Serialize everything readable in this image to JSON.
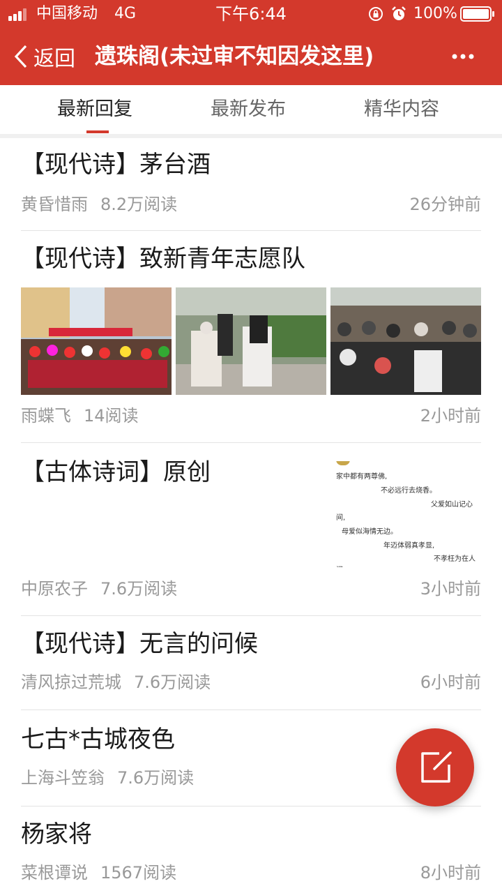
{
  "statusbar": {
    "carrier": "中国移动",
    "network": "4G",
    "time": "下午6:44",
    "battery": "100%",
    "icons": [
      "signal-icon",
      "orientation-lock-icon",
      "alarm-icon",
      "battery-icon"
    ]
  },
  "navbar": {
    "back_label": "返回",
    "title": "遗珠阁(未过审不知因发这里)",
    "more_icon": "more-dots-icon",
    "background": "#d3392c"
  },
  "tabs": [
    {
      "label": "最新回复",
      "active": true
    },
    {
      "label": "最新发布",
      "active": false
    },
    {
      "label": "精华内容",
      "active": false
    }
  ],
  "posts": [
    {
      "title": "【现代诗】茅台酒",
      "author": "黄昏惜雨",
      "reads": "8.2万阅读",
      "time": "26分钟前"
    },
    {
      "title": "【现代诗】致新青年志愿队",
      "author": "雨蝶飞",
      "reads": "14阅读",
      "time": "2小时前"
    },
    {
      "title": "【古体诗词】原创",
      "author": "中原农子",
      "reads": "7.6万阅读",
      "time": "3小时前",
      "thumb_lines": [
        "家中都有两尊佛,",
        "不必远行去烧香。",
        "父爱如山记心",
        "间,",
        "母爱似海情无边。",
        "年迈体弱真孝显,",
        "不孝枉为在人",
        "间。"
      ]
    },
    {
      "title": "【现代诗】无言的问候",
      "author": "清风掠过荒城",
      "reads": "7.6万阅读",
      "time": "6小时前"
    },
    {
      "title": "七古*古城夜色",
      "author": "上海斗笠翁",
      "reads": "7.6万阅读",
      "time": ""
    },
    {
      "title": "杨家将",
      "author": "菜根谭说",
      "reads": "1567阅读",
      "time": "8小时前"
    }
  ],
  "fab": {
    "icon": "compose-icon",
    "color": "#d3392c"
  }
}
